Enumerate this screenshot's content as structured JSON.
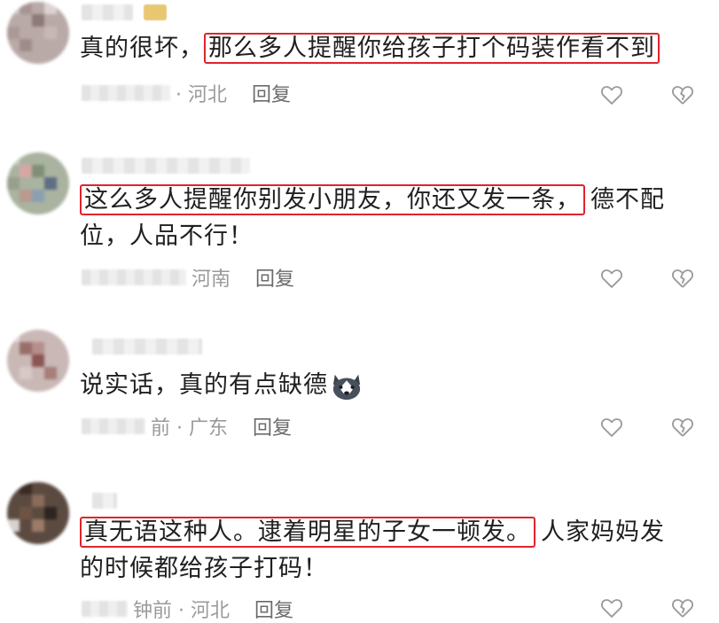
{
  "comments": [
    {
      "prefix": "真的很坏，",
      "highlight": "那么多人提醒你给孩子打个码装作看不到",
      "suffix": "",
      "line2": "",
      "location": "· 河北",
      "reply_label": "回复"
    },
    {
      "prefix": "",
      "highlight": "这么多人提醒你别发小朋友，你还又发一条，",
      "suffix": "德不配",
      "line2": "位，人品不行！",
      "location": "河南",
      "reply_label": "回复"
    },
    {
      "prefix": "说实话，真的有点缺德",
      "highlight": "",
      "suffix": "",
      "line2": "",
      "location": "前 · 广东",
      "reply_label": "回复"
    },
    {
      "prefix": "",
      "highlight": "真无语这种人。逮着明星的子女一顿发。",
      "suffix": "人家妈妈发",
      "line2": "的时候都给孩子打码！",
      "location": "钟前 · 河北",
      "reply_label": "回复"
    }
  ],
  "icons": {
    "like": "heart-outline-icon",
    "dislike": "broken-heart-outline-icon",
    "emoji": "husky-dog-emoji"
  },
  "colors": {
    "highlight_border": "#e0242c",
    "meta_text": "#8c8c8c",
    "body_text": "#202020"
  }
}
